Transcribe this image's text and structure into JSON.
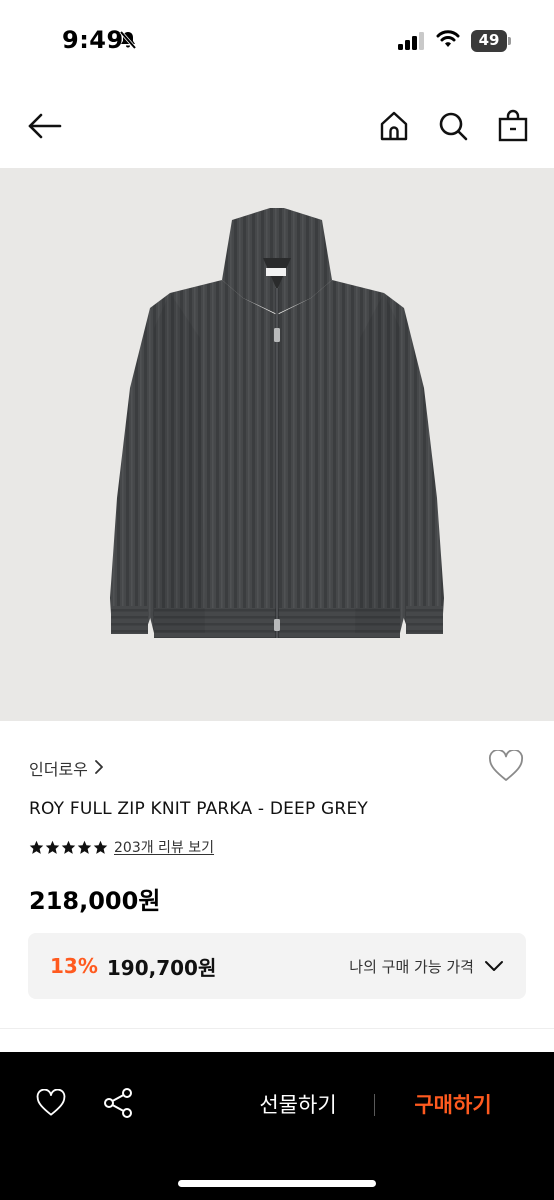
{
  "status_bar": {
    "time": "9:49",
    "battery": "49",
    "icons": [
      "bell-off-icon",
      "signal-icon",
      "wifi-icon",
      "battery-icon"
    ]
  },
  "nav": {
    "icons": [
      "back-arrow-icon",
      "home-icon",
      "search-icon",
      "shopping-bag-icon"
    ]
  },
  "product": {
    "image": "dark grey ribbed full-zip knit jacket with high collar",
    "brand": "인더로우",
    "name": "ROY FULL ZIP KNIT PARKA - DEEP GREY",
    "rating_stars": 5,
    "review_link": "203개 리뷰 보기",
    "price": "218,000원"
  },
  "my_price": {
    "discount": "13%",
    "sale_price": "190,700원",
    "label": "나의 구매 가능 가격"
  },
  "bottom_bar": {
    "gift_label": "선물하기",
    "buy_label": "구매하기",
    "icons": [
      "heart-icon",
      "share-icon"
    ]
  },
  "colors": {
    "accent": "#ff5a1f",
    "bottom_bar": "#000000",
    "image_bg": "#e9e8e6",
    "price_box": "#f3f3f3"
  }
}
